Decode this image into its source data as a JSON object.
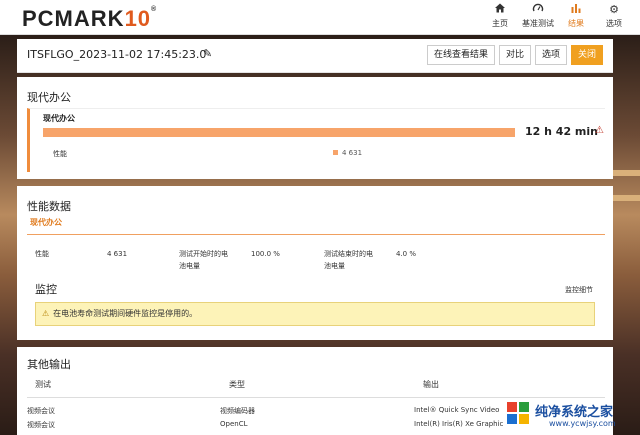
{
  "brand": {
    "logo_main": "PCMARK",
    "logo_num": "10",
    "logo_reg": "®"
  },
  "nav": [
    {
      "icon": "home-icon",
      "label": "主页",
      "active": false
    },
    {
      "icon": "gauge-icon",
      "label": "基准测试",
      "active": false
    },
    {
      "icon": "bar-chart-icon",
      "label": "结果",
      "active": true
    },
    {
      "icon": "gear-icon",
      "label": "选项",
      "active": false
    }
  ],
  "result": {
    "name": "ITSFLGO_2023-11-02 17:45:23.0",
    "buttons": {
      "online": "在线查看结果",
      "compare": "对比",
      "options": "选项",
      "close": "关闭"
    }
  },
  "office": {
    "section_title": "现代办公",
    "box_label": "现代办公",
    "battery_time": "12 h 42 min",
    "bar_fraction": 1.0,
    "perf_label": "性能",
    "perf_value": "4 631"
  },
  "perf_data": {
    "title": "性能数据",
    "subtitle": "现代办公",
    "perf_label": "性能",
    "perf_value": "4 631",
    "start_label_1": "测试开始时的电",
    "start_label_2": "池电量",
    "start_value": "100.0 %",
    "end_label_1": "测试结束时的电",
    "end_label_2": "池电量",
    "end_value": "4.0 %"
  },
  "monitor": {
    "title": "监控",
    "details_link": "监控细节",
    "warning": "在电池寿命测试期间硬件监控是停用的。"
  },
  "other": {
    "title": "其他输出",
    "headers": [
      "测试",
      "类型",
      "输出"
    ],
    "rows": [
      [
        "视频会议",
        "视频编码器",
        "Intel® Quick Sync Video"
      ],
      [
        "视频会议",
        "OpenCL",
        "Intel(R) Iris(R) Xe Graphic"
      ]
    ]
  },
  "watermark": {
    "name": "纯净系统之家",
    "url": "www.ycwjsy.com"
  },
  "colors": {
    "accent": "#e07b1e",
    "bar": "#f7a46a",
    "warn_bg": "#fdf3b8"
  }
}
